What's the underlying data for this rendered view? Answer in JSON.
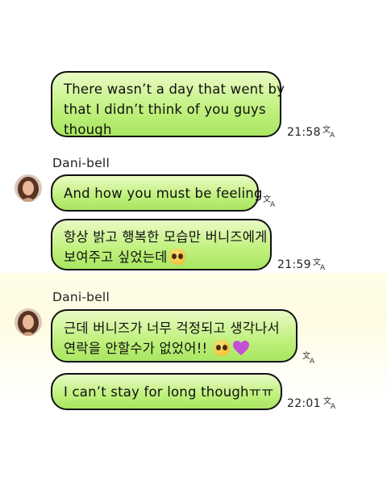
{
  "icons": {
    "translate": "translate-icon",
    "avatar": "avatar-photo",
    "emoji_pleading": "pleading-face-emoji",
    "emoji_heart": "purple-heart-emoji"
  },
  "colors": {
    "bubble": "#bff07c",
    "border": "#111111",
    "heart": "#c24fd6"
  },
  "messages": [
    {
      "lines": [
        "There wasn’t a day that went by",
        "that I didn’t think of you guys",
        "though"
      ],
      "time": "21:58"
    },
    {
      "sender": "Dani-bell",
      "lines": [
        "And how you must be feeling"
      ]
    },
    {
      "lines": [
        "항상 밝고 행복한 모습만 버니즈에게",
        "보여주고  싶었는데"
      ],
      "time": "21:59"
    },
    {
      "sender": "Dani-bell",
      "lines": [
        "근데 버니즈가 너무 걱정되고 생각나서",
        "연락을 안할수가 없었어!!"
      ]
    },
    {
      "lines": [
        "I can’t stay for long thoughㅠㅠ"
      ],
      "time": "22:01"
    }
  ]
}
